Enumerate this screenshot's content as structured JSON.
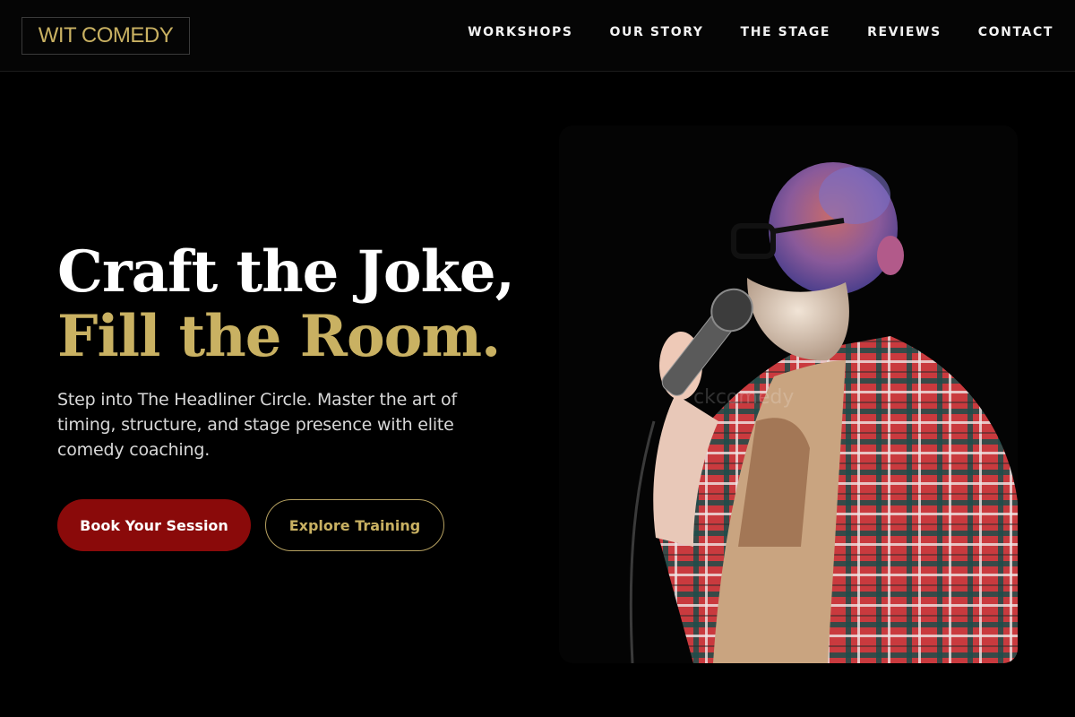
{
  "brand": {
    "logo_text": "WIT COMEDY"
  },
  "nav": {
    "items": [
      {
        "label": "WORKSHOPS"
      },
      {
        "label": "OUR STORY"
      },
      {
        "label": "THE STAGE"
      },
      {
        "label": "REVIEWS"
      },
      {
        "label": "CONTACT"
      }
    ]
  },
  "hero": {
    "title_line1": "Craft the Joke,",
    "title_line2": "Fill the Room.",
    "description": "Step into The Headliner Circle. Master the art of timing, structure, and stage presence with elite comedy coaching.",
    "primary_button": "Book Your Session",
    "secondary_button": "Explore Training",
    "image_watermark": "ckcomedy"
  },
  "colors": {
    "background": "#000000",
    "accent_gold": "#c9b162",
    "primary_red": "#8a0a0a",
    "text_light": "#d8d8d8"
  }
}
